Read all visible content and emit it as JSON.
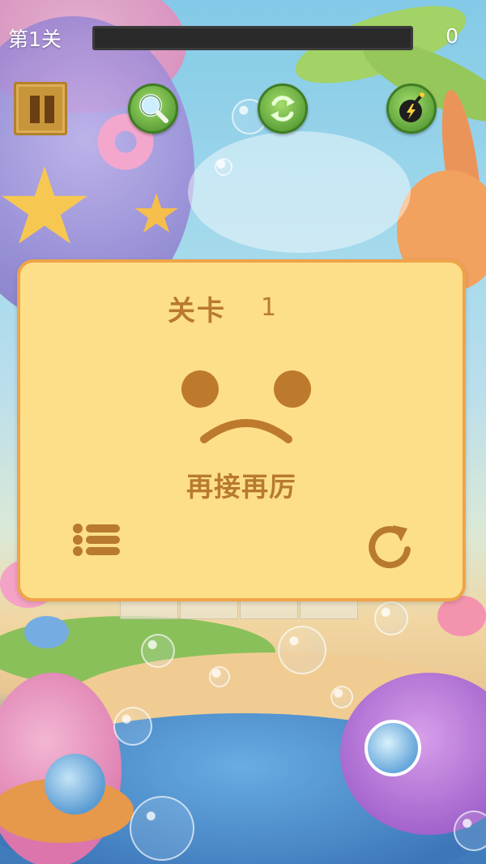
{
  "hud": {
    "level_label": "第1关",
    "score": "0",
    "progress": 0
  },
  "toolbar": {
    "pause": "pause-icon",
    "magnify": "magnifier-icon",
    "shuffle": "shuffle-icon",
    "bomb": "bomb-icon"
  },
  "modal": {
    "title": "关卡",
    "level_number": "1",
    "message": "再接再厉",
    "face": "sad-face-icon",
    "menu": "menu-list-icon",
    "retry": "retry-icon"
  },
  "colors": {
    "panel_bg": "#fedf89",
    "panel_border": "#efa448",
    "text_brown": "#b87a2e",
    "tool_green": "#5ea23a"
  }
}
